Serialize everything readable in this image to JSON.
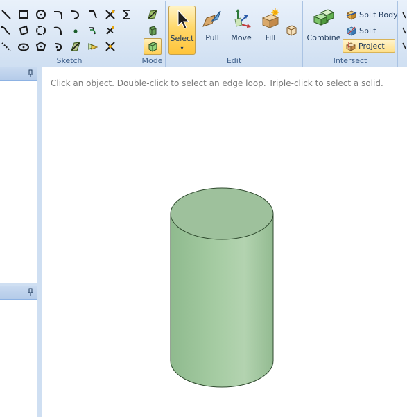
{
  "ribbon": {
    "groups": {
      "sketch": "Sketch",
      "mode": "Mode",
      "edit": "Edit",
      "intersect": "Intersect"
    },
    "edit_buttons": {
      "select": "Select",
      "pull": "Pull",
      "move": "Move",
      "fill": "Fill"
    },
    "intersect_buttons": {
      "combine": "Combine",
      "split_body": "Split Body",
      "split": "Split",
      "project": "Project"
    }
  },
  "viewport": {
    "hint": "Click an object. Double-click to select an edge loop. Triple-click to select a solid."
  },
  "colors": {
    "accent_active": "#ffc43a",
    "ribbon_bg": "#dbe7f5",
    "cylinder_fill": "#9dc39b",
    "cylinder_edge": "#2f4a2e"
  },
  "icons": {
    "sketch_tools": [
      "line-icon",
      "rectangle-icon",
      "circle-icon",
      "tangent-arc-icon",
      "three-point-arc-icon",
      "bend-line-icon",
      "trim-icon",
      "sigma-icon",
      "spline-icon",
      "three-point-rectangle-icon",
      "three-point-circle-icon",
      "swept-arc-icon",
      "point-icon",
      "offset-curve-icon",
      "move-grid-icon",
      "polyline-icon",
      "ellipse-icon",
      "polygon-icon",
      "sweep-arc-icon",
      "face-curve-icon",
      "project-to-sketch-icon",
      "extend-icon"
    ],
    "mode": [
      "sketch-mode-icon",
      "section-mode-icon",
      "3d-mode-icon"
    ]
  }
}
